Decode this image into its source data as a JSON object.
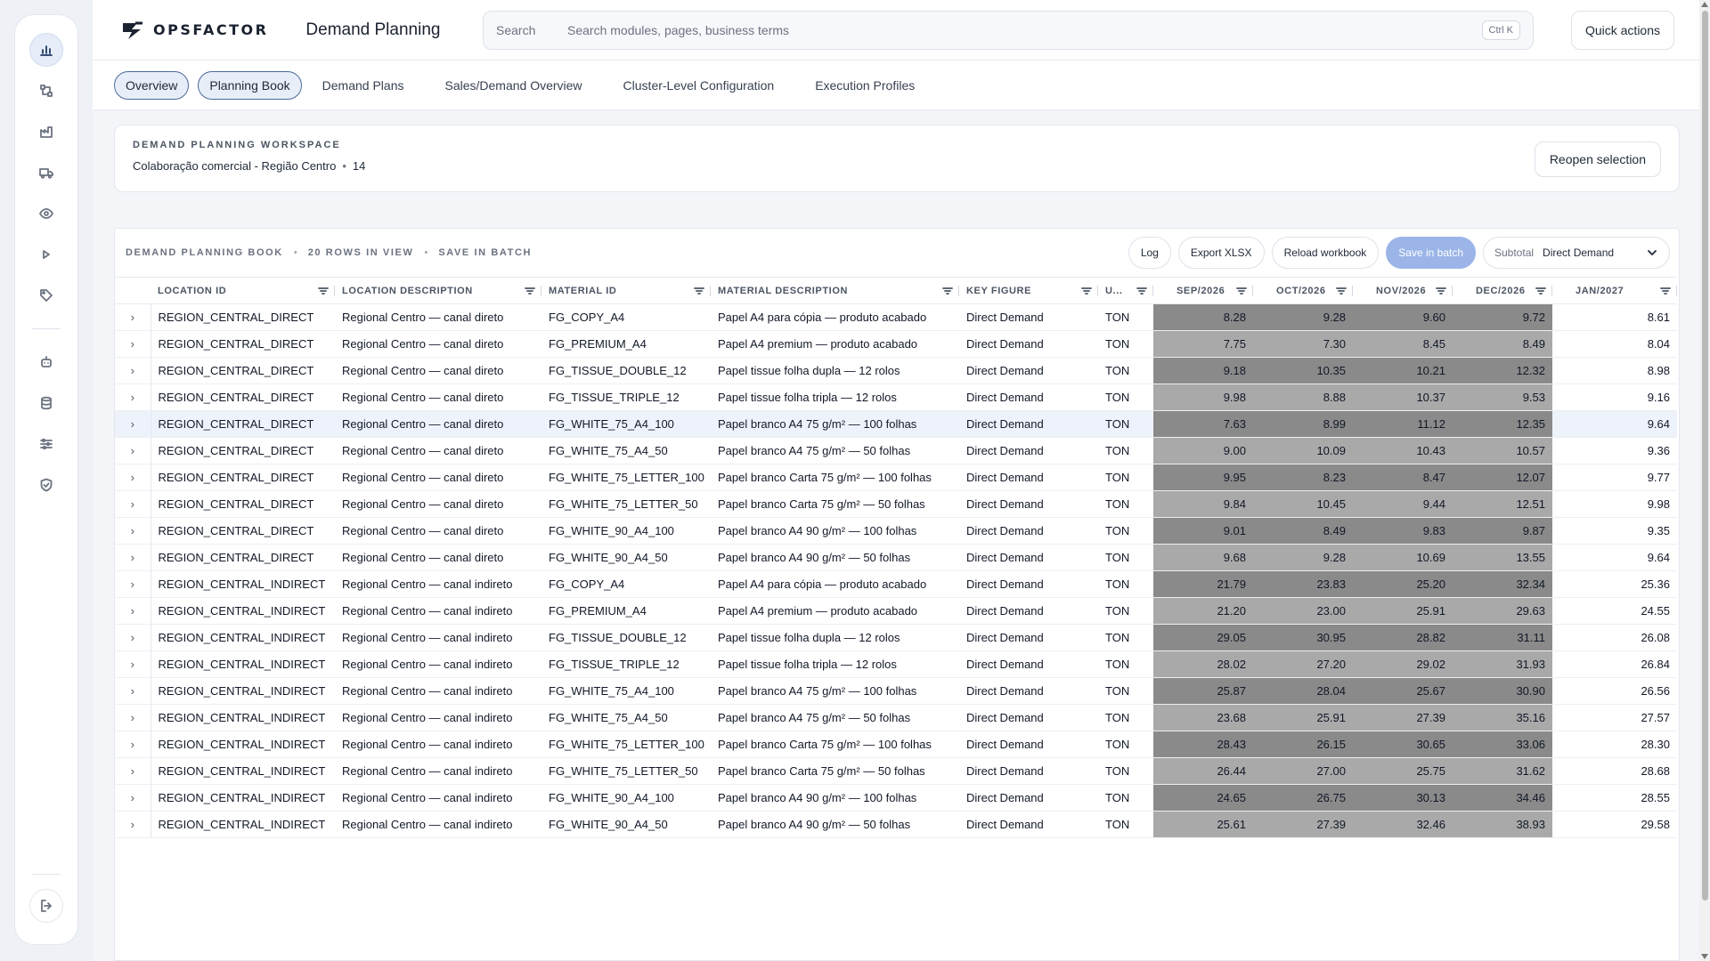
{
  "app": {
    "brand": "OPSFACTOR",
    "title": "Demand Planning",
    "colors": {
      "accent": "#9bb5e8",
      "tab_border": "#4b6a9b"
    }
  },
  "search": {
    "label": "Search",
    "placeholder": "Search modules, pages, business terms",
    "shortcut": "Ctrl K"
  },
  "quick_actions": "Quick actions",
  "rail": {
    "top_icons": [
      "chart-icon",
      "network-icon",
      "factory-icon",
      "truck-icon",
      "eye-icon",
      "play-icon",
      "tag-icon"
    ],
    "mid_icons": [
      "robot-icon",
      "database-icon",
      "sliders-icon",
      "shield-check-icon"
    ],
    "bottom_icon": "logout-icon"
  },
  "tabs": [
    {
      "label": "Overview"
    },
    {
      "label": "Planning Book"
    },
    {
      "label": "Demand Plans"
    },
    {
      "label": "Sales/Demand Overview"
    },
    {
      "label": "Cluster-Level Configuration"
    },
    {
      "label": "Execution Profiles"
    }
  ],
  "workspace": {
    "kicker": "DEMAND PLANNING WORKSPACE",
    "selection": "Colaboração comercial - Região Centro",
    "count": "14",
    "reopen": "Reopen selection"
  },
  "grid": {
    "label": "DEMAND PLANNING BOOK",
    "rows_in_view": "20 ROWS IN VIEW",
    "save_mode": "SAVE IN BATCH",
    "buttons": {
      "log": "Log",
      "export": "Export XLSX",
      "reload": "Reload workbook",
      "save": "Save in batch"
    },
    "subtotal": {
      "label": "Subtotal",
      "value": "Direct Demand"
    },
    "columns": [
      "LOCATION ID",
      "LOCATION DESCRIPTION",
      "MATERIAL ID",
      "MATERIAL DESCRIPTION",
      "KEY FIGURE",
      "U...",
      "SEP/2026",
      "OCT/2026",
      "NOV/2026",
      "DEC/2026",
      "JAN/2027"
    ],
    "expand_glyph": "›",
    "rows": [
      [
        "REGION_CENTRAL_DIRECT",
        "Regional Centro — canal direto",
        "FG_COPY_A4",
        "Papel A4 para cópia — produto acabado",
        "Direct Demand",
        "TON",
        "8.28",
        "9.28",
        "9.60",
        "9.72",
        "8.61"
      ],
      [
        "REGION_CENTRAL_DIRECT",
        "Regional Centro — canal direto",
        "FG_PREMIUM_A4",
        "Papel A4 premium — produto acabado",
        "Direct Demand",
        "TON",
        "7.75",
        "7.30",
        "8.45",
        "8.49",
        "8.04"
      ],
      [
        "REGION_CENTRAL_DIRECT",
        "Regional Centro — canal direto",
        "FG_TISSUE_DOUBLE_12",
        "Papel tissue folha dupla — 12 rolos",
        "Direct Demand",
        "TON",
        "9.18",
        "10.35",
        "10.21",
        "12.32",
        "8.98"
      ],
      [
        "REGION_CENTRAL_DIRECT",
        "Regional Centro — canal direto",
        "FG_TISSUE_TRIPLE_12",
        "Papel tissue folha tripla — 12 rolos",
        "Direct Demand",
        "TON",
        "9.98",
        "8.88",
        "10.37",
        "9.53",
        "9.16"
      ],
      [
        "REGION_CENTRAL_DIRECT",
        "Regional Centro — canal direto",
        "FG_WHITE_75_A4_100",
        "Papel branco A4 75 g/m² — 100 folhas",
        "Direct Demand",
        "TON",
        "7.63",
        "8.99",
        "11.12",
        "12.35",
        "9.64"
      ],
      [
        "REGION_CENTRAL_DIRECT",
        "Regional Centro — canal direto",
        "FG_WHITE_75_A4_50",
        "Papel branco A4 75 g/m² — 50 folhas",
        "Direct Demand",
        "TON",
        "9.00",
        "10.09",
        "10.43",
        "10.57",
        "9.36"
      ],
      [
        "REGION_CENTRAL_DIRECT",
        "Regional Centro — canal direto",
        "FG_WHITE_75_LETTER_100",
        "Papel branco Carta 75 g/m² — 100 folhas",
        "Direct Demand",
        "TON",
        "9.95",
        "8.23",
        "8.47",
        "12.07",
        "9.77"
      ],
      [
        "REGION_CENTRAL_DIRECT",
        "Regional Centro — canal direto",
        "FG_WHITE_75_LETTER_50",
        "Papel branco Carta 75 g/m² — 50 folhas",
        "Direct Demand",
        "TON",
        "9.84",
        "10.45",
        "9.44",
        "12.51",
        "9.98"
      ],
      [
        "REGION_CENTRAL_DIRECT",
        "Regional Centro — canal direto",
        "FG_WHITE_90_A4_100",
        "Papel branco A4 90 g/m² — 100 folhas",
        "Direct Demand",
        "TON",
        "9.01",
        "8.49",
        "9.83",
        "9.87",
        "9.35"
      ],
      [
        "REGION_CENTRAL_DIRECT",
        "Regional Centro — canal direto",
        "FG_WHITE_90_A4_50",
        "Papel branco A4 90 g/m² — 50 folhas",
        "Direct Demand",
        "TON",
        "9.68",
        "9.28",
        "10.69",
        "13.55",
        "9.64"
      ],
      [
        "REGION_CENTRAL_INDIRECT",
        "Regional Centro — canal indireto",
        "FG_COPY_A4",
        "Papel A4 para cópia — produto acabado",
        "Direct Demand",
        "TON",
        "21.79",
        "23.83",
        "25.20",
        "32.34",
        "25.36"
      ],
      [
        "REGION_CENTRAL_INDIRECT",
        "Regional Centro — canal indireto",
        "FG_PREMIUM_A4",
        "Papel A4 premium — produto acabado",
        "Direct Demand",
        "TON",
        "21.20",
        "23.00",
        "25.91",
        "29.63",
        "24.55"
      ],
      [
        "REGION_CENTRAL_INDIRECT",
        "Regional Centro — canal indireto",
        "FG_TISSUE_DOUBLE_12",
        "Papel tissue folha dupla — 12 rolos",
        "Direct Demand",
        "TON",
        "29.05",
        "30.95",
        "28.82",
        "31.11",
        "26.08"
      ],
      [
        "REGION_CENTRAL_INDIRECT",
        "Regional Centro — canal indireto",
        "FG_TISSUE_TRIPLE_12",
        "Papel tissue folha tripla — 12 rolos",
        "Direct Demand",
        "TON",
        "28.02",
        "27.20",
        "29.02",
        "31.93",
        "26.84"
      ],
      [
        "REGION_CENTRAL_INDIRECT",
        "Regional Centro — canal indireto",
        "FG_WHITE_75_A4_100",
        "Papel branco A4 75 g/m² — 100 folhas",
        "Direct Demand",
        "TON",
        "25.87",
        "28.04",
        "25.67",
        "30.90",
        "26.56"
      ],
      [
        "REGION_CENTRAL_INDIRECT",
        "Regional Centro — canal indireto",
        "FG_WHITE_75_A4_50",
        "Papel branco A4 75 g/m² — 50 folhas",
        "Direct Demand",
        "TON",
        "23.68",
        "25.91",
        "27.39",
        "35.16",
        "27.57"
      ],
      [
        "REGION_CENTRAL_INDIRECT",
        "Regional Centro — canal indireto",
        "FG_WHITE_75_LETTER_100",
        "Papel branco Carta 75 g/m² — 100 folhas",
        "Direct Demand",
        "TON",
        "28.43",
        "26.15",
        "30.65",
        "33.06",
        "28.30"
      ],
      [
        "REGION_CENTRAL_INDIRECT",
        "Regional Centro — canal indireto",
        "FG_WHITE_75_LETTER_50",
        "Papel branco Carta 75 g/m² — 50 folhas",
        "Direct Demand",
        "TON",
        "26.44",
        "27.00",
        "25.75",
        "31.62",
        "28.68"
      ],
      [
        "REGION_CENTRAL_INDIRECT",
        "Regional Centro — canal indireto",
        "FG_WHITE_90_A4_100",
        "Papel branco A4 90 g/m² — 100 folhas",
        "Direct Demand",
        "TON",
        "24.65",
        "26.75",
        "30.13",
        "34.46",
        "28.55"
      ],
      [
        "REGION_CENTRAL_INDIRECT",
        "Regional Centro — canal indireto",
        "FG_WHITE_90_A4_50",
        "Papel branco A4 90 g/m² — 50 folhas",
        "Direct Demand",
        "TON",
        "25.61",
        "27.39",
        "32.46",
        "38.93",
        "29.58"
      ]
    ],
    "highlighted_row": 4,
    "shade_colors": {
      "dark": "#8a8a8a",
      "light": "#a9a9a9"
    }
  }
}
